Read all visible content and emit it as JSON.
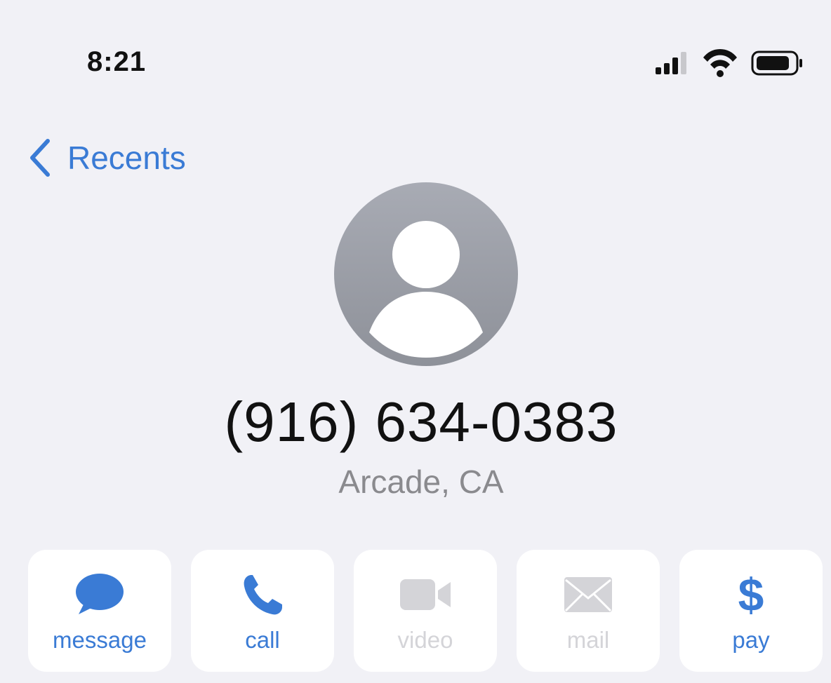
{
  "status_bar": {
    "time": "8:21",
    "icons": [
      "cellular-signal-icon",
      "wifi-icon",
      "battery-icon"
    ]
  },
  "nav": {
    "back_label": "Recents"
  },
  "contact": {
    "phone_number": "(916) 634-0383",
    "location": "Arcade, CA"
  },
  "actions": [
    {
      "label": "message",
      "icon": "message-bubble-icon",
      "enabled": true
    },
    {
      "label": "call",
      "icon": "phone-icon",
      "enabled": true
    },
    {
      "label": "video",
      "icon": "video-camera-icon",
      "enabled": false
    },
    {
      "label": "mail",
      "icon": "envelope-icon",
      "enabled": false
    },
    {
      "label": "pay",
      "icon": "dollar-sign-icon",
      "symbol": "$",
      "enabled": true
    }
  ],
  "colors": {
    "accent": "#3a7bd5",
    "disabled": "#d4d4d8",
    "background": "#f1f1f6",
    "avatar": "#9a9da5",
    "secondary_text": "#8a8a8e"
  }
}
